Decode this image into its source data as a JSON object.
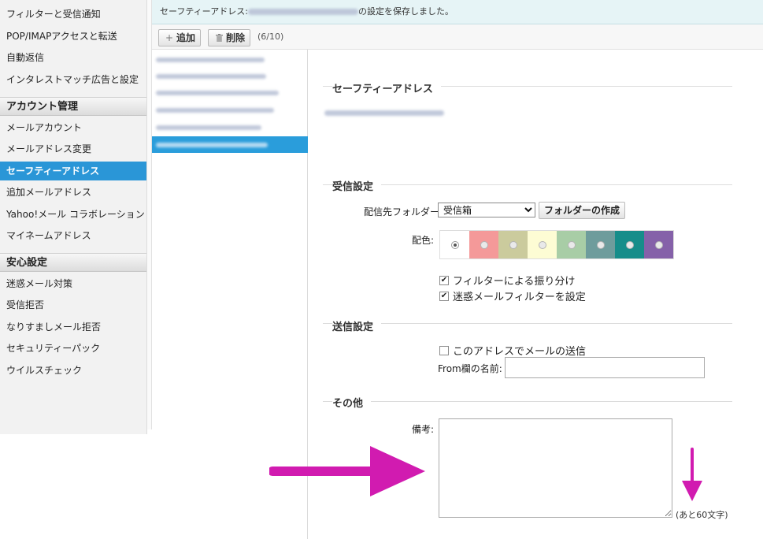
{
  "sidebar": {
    "items_top": [
      "フィルターと受信通知",
      "POP/IMAPアクセスと転送",
      "自動返信",
      "インタレストマッチ広告と設定"
    ],
    "section_account": "アカウント管理",
    "items_account": [
      "メールアカウント",
      "メールアドレス変更",
      "セーフティーアドレス",
      "追加メールアドレス",
      "Yahoo!メール コラボレーション",
      "マイネームアドレス"
    ],
    "section_safety": "安心設定",
    "items_safety": [
      "迷惑メール対策",
      "受信拒否",
      "なりすましメール拒否",
      "セキュリティーパック",
      "ウイルスチェック"
    ]
  },
  "notice": {
    "prefix": "セーフティーアドレス:",
    "suffix": "の設定を保存しました。"
  },
  "toolbar": {
    "add_label": "追加",
    "delete_label": "削除",
    "count": "(6/10)"
  },
  "detail": {
    "safety_title": "セーフティーアドレス",
    "receive_title": "受信設定",
    "folder_label": "配信先フォルダー:",
    "folder_value": "受信箱",
    "create_folder_label": "フォルダーの作成",
    "color_label": "配色:",
    "filter_sort_label": "フィルターによる振り分け",
    "spam_filter_label": "迷惑メールフィルターを設定",
    "send_title": "送信設定",
    "send_with_address_label": "このアドレスでメールの送信",
    "from_name_label": "From欄の名前:",
    "other_title": "その他",
    "memo_label": "備考:",
    "remaining_label": "(あと60文字)"
  },
  "colors": {
    "swatches": [
      "#ffffff",
      "#f49999",
      "#cbcb9d",
      "#fdfcd4",
      "#a8cda6",
      "#6e9c9c",
      "#168d8a",
      "#8561a9"
    ],
    "selected_index": 0,
    "accent": "#2a96d7",
    "arrow": "#d11bb0"
  },
  "checkbox_state": {
    "filter_sort": true,
    "spam_filter": true,
    "send_with_address": false
  }
}
